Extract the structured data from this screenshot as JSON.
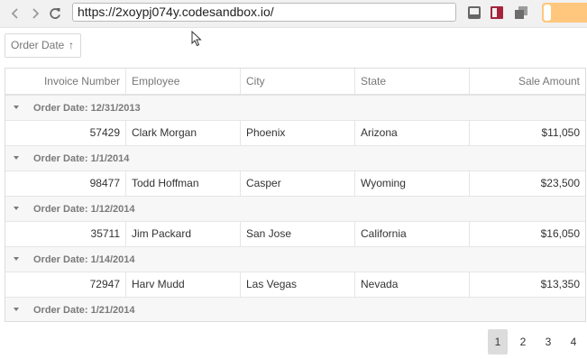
{
  "browser": {
    "url": "https://2xoypj074y.codesandbox.io/"
  },
  "group_panel": {
    "chip_label": "Order Date",
    "sort_arrow": "↑"
  },
  "grid": {
    "columns": [
      "Invoice Number",
      "Employee",
      "City",
      "State",
      "Sale Amount"
    ],
    "groups": [
      {
        "label": "Order Date: 12/31/2013",
        "rows": [
          [
            "57429",
            "Clark Morgan",
            "Phoenix",
            "Arizona",
            "$11,050"
          ]
        ]
      },
      {
        "label": "Order Date: 1/1/2014",
        "rows": [
          [
            "98477",
            "Todd Hoffman",
            "Casper",
            "Wyoming",
            "$23,500"
          ]
        ]
      },
      {
        "label": "Order Date: 1/12/2014",
        "rows": [
          [
            "35711",
            "Jim Packard",
            "San Jose",
            "California",
            "$16,050"
          ]
        ]
      },
      {
        "label": "Order Date: 1/14/2014",
        "rows": [
          [
            "72947",
            "Harv Mudd",
            "Las Vegas",
            "Nevada",
            "$13,350"
          ]
        ]
      },
      {
        "label": "Order Date: 1/21/2014",
        "rows": []
      }
    ]
  },
  "pager": {
    "pages": [
      "1",
      "2",
      "3",
      "4"
    ],
    "current": "1"
  },
  "colors": {
    "toggle": "#ffc77d",
    "book_icon": "#a4243b"
  }
}
